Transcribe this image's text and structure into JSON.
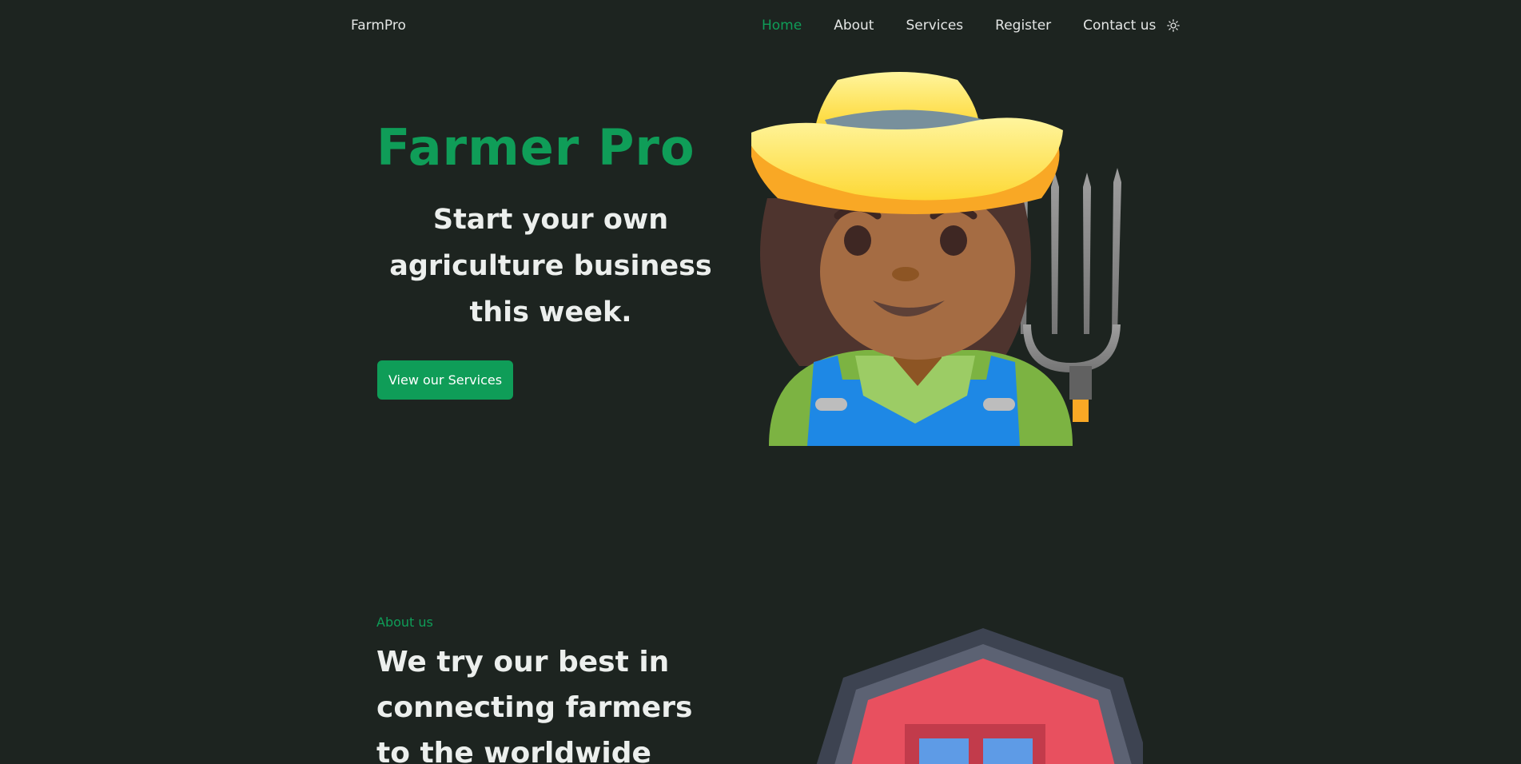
{
  "header": {
    "logo": "FarmPro",
    "nav": [
      {
        "label": "Home",
        "active": true
      },
      {
        "label": "About",
        "active": false
      },
      {
        "label": "Services",
        "active": false
      },
      {
        "label": "Register",
        "active": false
      },
      {
        "label": "Contact us",
        "active": false
      }
    ],
    "theme_toggle_icon": "sun-icon"
  },
  "hero": {
    "title": "Farmer Pro",
    "subtitle": "Start your own agriculture business this week.",
    "cta_label": "View our Services",
    "illustration_icon": "farmer-emoji"
  },
  "about": {
    "eyebrow": "About us",
    "title": "We try our best in connecting farmers to the worldwide",
    "illustration_icon": "barn-emoji"
  },
  "colors": {
    "background": "#1d2420",
    "accent": "#0f9d58",
    "text": "#ecefed"
  }
}
